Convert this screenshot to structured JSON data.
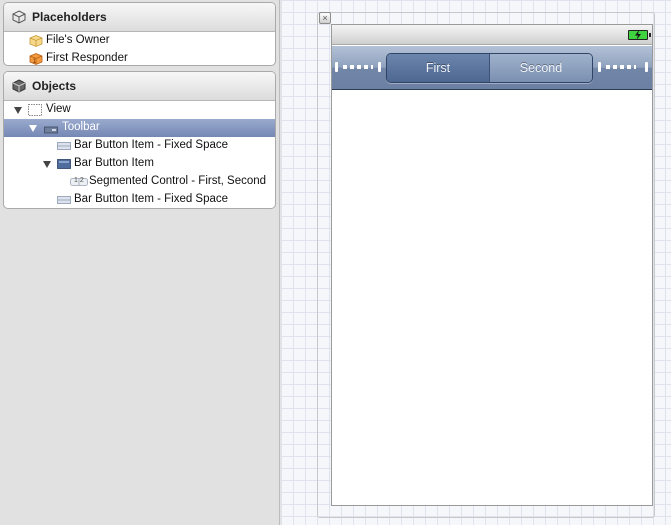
{
  "outline": {
    "placeholders": {
      "header": "Placeholders",
      "items": [
        {
          "label": "File's Owner",
          "icon": "cube-icon"
        },
        {
          "label": "First Responder",
          "icon": "first-responder-icon"
        }
      ]
    },
    "objects": {
      "header": "Objects",
      "items": [
        {
          "label": "View",
          "icon": "view-icon",
          "expanded": true
        },
        {
          "label": "Toolbar",
          "icon": "toolbar-icon",
          "expanded": true,
          "selected": true
        },
        {
          "label": "Bar Button Item - Fixed Space",
          "icon": "bar-button-item-icon"
        },
        {
          "label": "Bar Button Item",
          "icon": "bar-button-item-icon",
          "expanded": true
        },
        {
          "label": "Segmented Control - First, Second",
          "icon": "segmented-control-icon"
        },
        {
          "label": "Bar Button Item - Fixed Space",
          "icon": "bar-button-item-icon"
        }
      ]
    }
  },
  "canvas": {
    "segmented_control": {
      "segments": [
        "First",
        "Second"
      ],
      "selected_index": 0
    },
    "seg_icon_text": "1 2",
    "colors": {
      "toolbar": "#7a8eb0",
      "selection": "#7588b4",
      "battery": "#3fd43f"
    }
  }
}
